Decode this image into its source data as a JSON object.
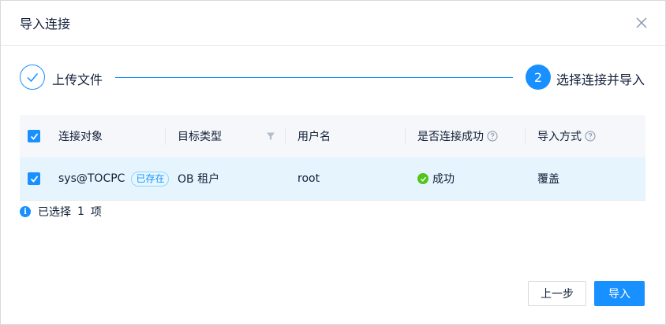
{
  "dialog": {
    "title": "导入连接",
    "close_icon": "close-icon"
  },
  "steps": [
    {
      "label": "上传文件",
      "status": "finished"
    },
    {
      "number": "2",
      "label": "选择连接并导入",
      "status": "active"
    }
  ],
  "table": {
    "columns": [
      "连接对象",
      "目标类型",
      "用户名",
      "是否连接成功",
      "导入方式"
    ],
    "rows": [
      {
        "checked": true,
        "object": "sys@TOCPC",
        "tag": "已存在",
        "type": "OB 租户",
        "username": "root",
        "status": "成功",
        "mode": "覆盖"
      }
    ]
  },
  "selection": {
    "prefix": "已选择",
    "count": "1",
    "suffix": "项"
  },
  "footer": {
    "prev_label": "上一步",
    "import_label": "导入"
  },
  "colors": {
    "primary": "#1890ff",
    "success": "#52c41a",
    "row_selected_bg": "#e6f4fe",
    "header_bg": "#f5f7fa"
  }
}
